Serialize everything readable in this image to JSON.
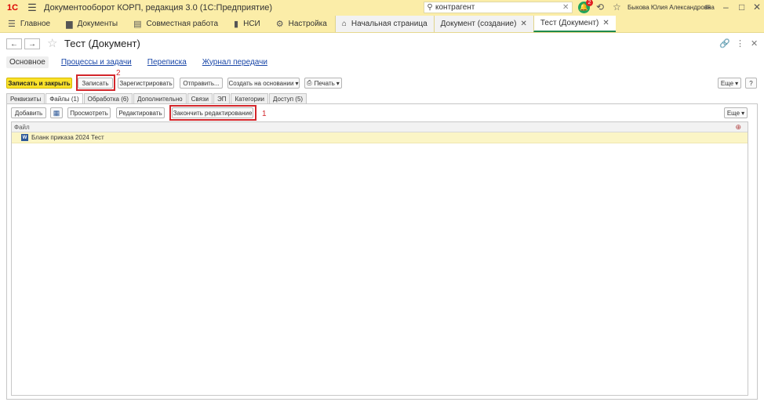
{
  "app": {
    "logo": "1С",
    "title": "Документооборот КОРП, редакция 3.0  (1С:Предприятие)",
    "search_value": "контрагент",
    "notifications": "2",
    "user": "Быкова Юлия Александровна"
  },
  "sections": [
    {
      "label": "Главное"
    },
    {
      "label": "Документы"
    },
    {
      "label": "Совместная работа"
    },
    {
      "label": "НСИ"
    },
    {
      "label": "Настройка"
    }
  ],
  "open_tabs": [
    {
      "label": "Начальная страница"
    },
    {
      "label": "Документ (создание)"
    },
    {
      "label": "Тест (Документ)"
    }
  ],
  "form": {
    "title": "Тест (Документ)",
    "nav_links": [
      "Основное",
      "Процессы и задачи",
      "Переписка",
      "Журнал передачи"
    ]
  },
  "commands": {
    "save_close": "Записать и закрыть",
    "save": "Записать",
    "register": "Зарегистрировать",
    "send": "Отправить...",
    "create_based": "Создать на основании",
    "print": "Печать",
    "more": "Еще",
    "help": "?"
  },
  "tabs": [
    "Реквизиты",
    "Файлы (1)",
    "Обработка (6)",
    "Дополнительно",
    "Связи",
    "ЭП",
    "Категории",
    "Доступ (5)"
  ],
  "files_commands": {
    "add": "Добавить",
    "view": "Просмотреть",
    "edit": "Редактировать",
    "finish_edit": "Закончить редактирование",
    "more": "Еще"
  },
  "file_list": {
    "column": "Файл",
    "rows": [
      {
        "name": "Бланк приказа 2024 Тест"
      }
    ]
  },
  "annotations": {
    "one": "1",
    "two": "2"
  }
}
